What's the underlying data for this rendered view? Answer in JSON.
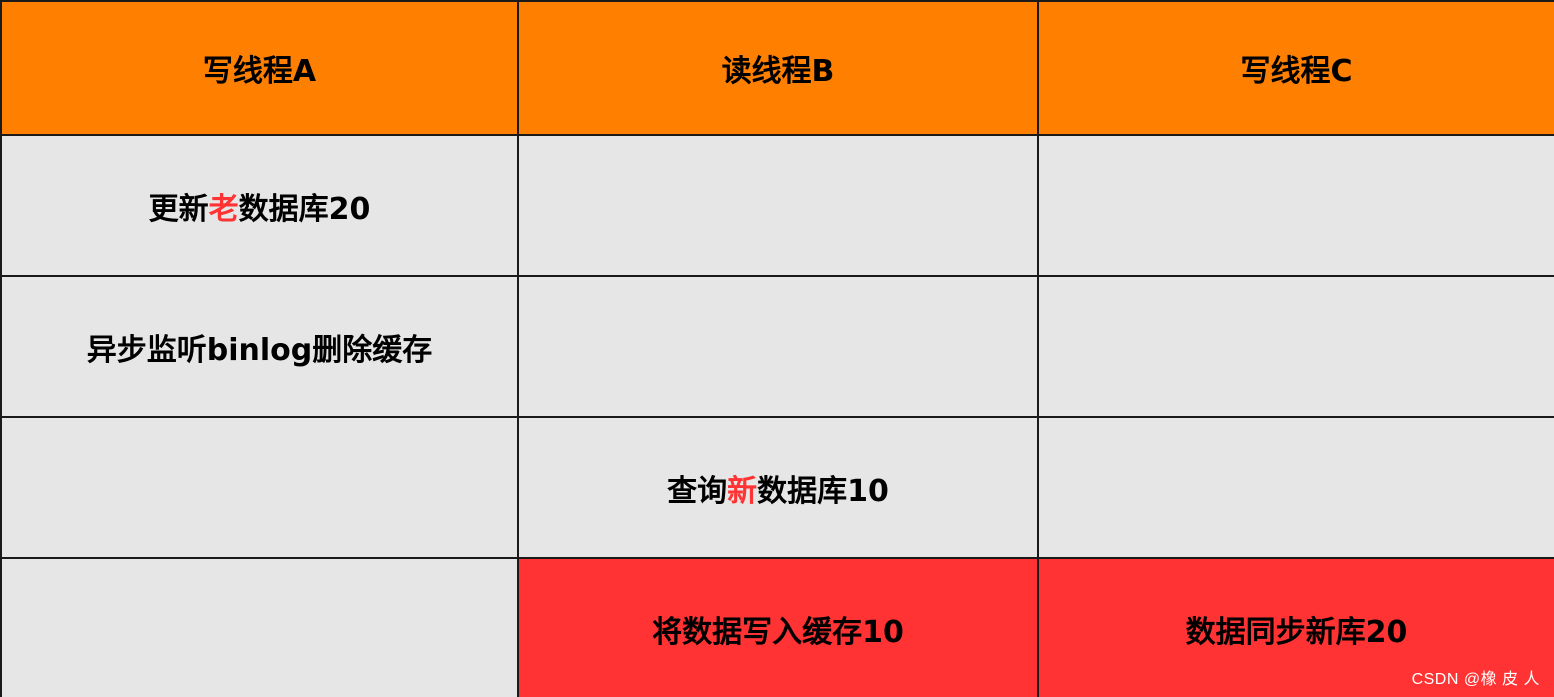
{
  "header": {
    "col_a": "写线程A",
    "col_b": "读线程B",
    "col_c": "写线程C"
  },
  "rows": [
    {
      "a": {
        "pre": "更新",
        "highlight": "老",
        "post": "数据库20"
      }
    },
    {
      "a": {
        "text": "异步监听binlog删除缓存"
      }
    },
    {
      "b": {
        "pre": "查询",
        "highlight": "新",
        "post": "数据库10"
      }
    },
    {
      "b": {
        "text": "将数据写入缓存10"
      },
      "c": {
        "text": "数据同步新库20"
      }
    }
  ],
  "colors": {
    "header_bg": "#ff8000",
    "cell_bg": "#e6e6e6",
    "alert_bg": "#ff3333",
    "highlight_text": "#ff3333"
  },
  "watermark": "CSDN @橡 皮 人"
}
